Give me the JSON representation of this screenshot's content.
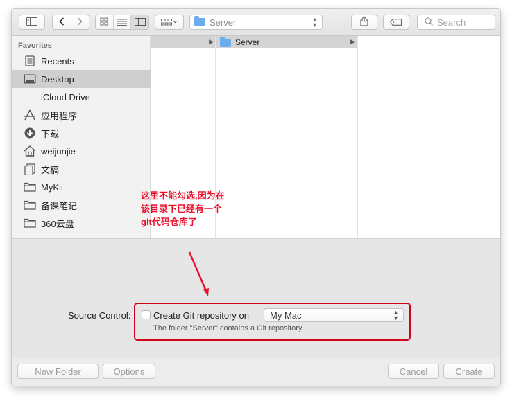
{
  "toolbar": {
    "path_folder": "Server",
    "search_placeholder": "Search"
  },
  "sidebar": {
    "heading": "Favorites",
    "items": [
      {
        "label": "Recents",
        "icon": "recents-icon"
      },
      {
        "label": "Desktop",
        "icon": "desktop-icon",
        "selected": true
      },
      {
        "label": "iCloud Drive",
        "icon": ""
      },
      {
        "label": "应用程序",
        "icon": "applications-icon"
      },
      {
        "label": "下载",
        "icon": "downloads-icon"
      },
      {
        "label": "weijunjie",
        "icon": "home-icon"
      },
      {
        "label": "文稿",
        "icon": "documents-icon"
      },
      {
        "label": "MyKit",
        "icon": "folder-icon"
      },
      {
        "label": "备课笔记",
        "icon": "folder-icon"
      },
      {
        "label": "360云盘",
        "icon": "folder-icon"
      }
    ]
  },
  "columns": {
    "col2_item": "Server"
  },
  "annotation": {
    "lines": [
      "这里不能勾选,因为在",
      "该目录下已经有一个",
      "git代码仓库了"
    ],
    "color": "#e8102a"
  },
  "source_control": {
    "label": "Source Control:",
    "checkbox_label": "Create Git repository on",
    "location": "My Mac",
    "hint": "The folder \"Server\" contains a Git repository."
  },
  "footer": {
    "new_folder": "New Folder",
    "options": "Options",
    "cancel": "Cancel",
    "create": "Create"
  }
}
